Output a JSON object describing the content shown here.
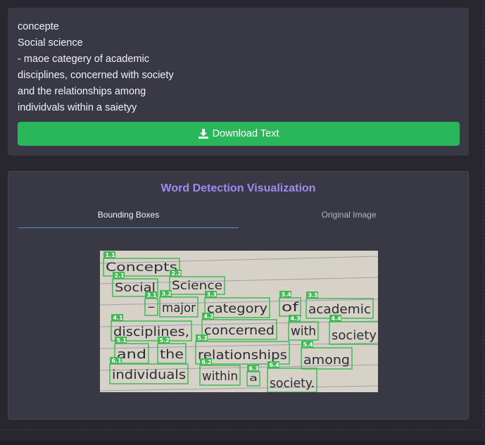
{
  "ocr_text": {
    "lines": [
      "concepte",
      "Social science",
      "- maoe categery of academic",
      "disciplines, concerned with society",
      "and the relationships among",
      "individvals within a saietyy"
    ]
  },
  "download_label": "Download Text",
  "visualization": {
    "title": "Word Detection Visualization",
    "tabs": [
      {
        "label": "Bounding Boxes",
        "active": true
      },
      {
        "label": "Original Image",
        "active": false
      }
    ],
    "box_color": "#44b857",
    "detections": [
      {
        "id": "1.1",
        "word": "Concepts"
      },
      {
        "id": "2.1",
        "word": "Social"
      },
      {
        "id": "2.2",
        "word": "Science"
      },
      {
        "id": "3.1",
        "word": "-"
      },
      {
        "id": "3.2",
        "word": "major"
      },
      {
        "id": "3.3",
        "word": "category"
      },
      {
        "id": "3.4",
        "word": "of"
      },
      {
        "id": "3.5",
        "word": "academic"
      },
      {
        "id": "4.1",
        "word": "disciplines,"
      },
      {
        "id": "4.2",
        "word": "concerned"
      },
      {
        "id": "4.3",
        "word": "with"
      },
      {
        "id": "4.4",
        "word": "society"
      },
      {
        "id": "5.1",
        "word": "and"
      },
      {
        "id": "5.2",
        "word": "the"
      },
      {
        "id": "5.3",
        "word": "relationships"
      },
      {
        "id": "5.4",
        "word": "among"
      },
      {
        "id": "6.1",
        "word": "individuals"
      },
      {
        "id": "6.2",
        "word": "within"
      },
      {
        "id": "6.3",
        "word": "a"
      },
      {
        "id": "6.4",
        "word": "society."
      }
    ]
  }
}
